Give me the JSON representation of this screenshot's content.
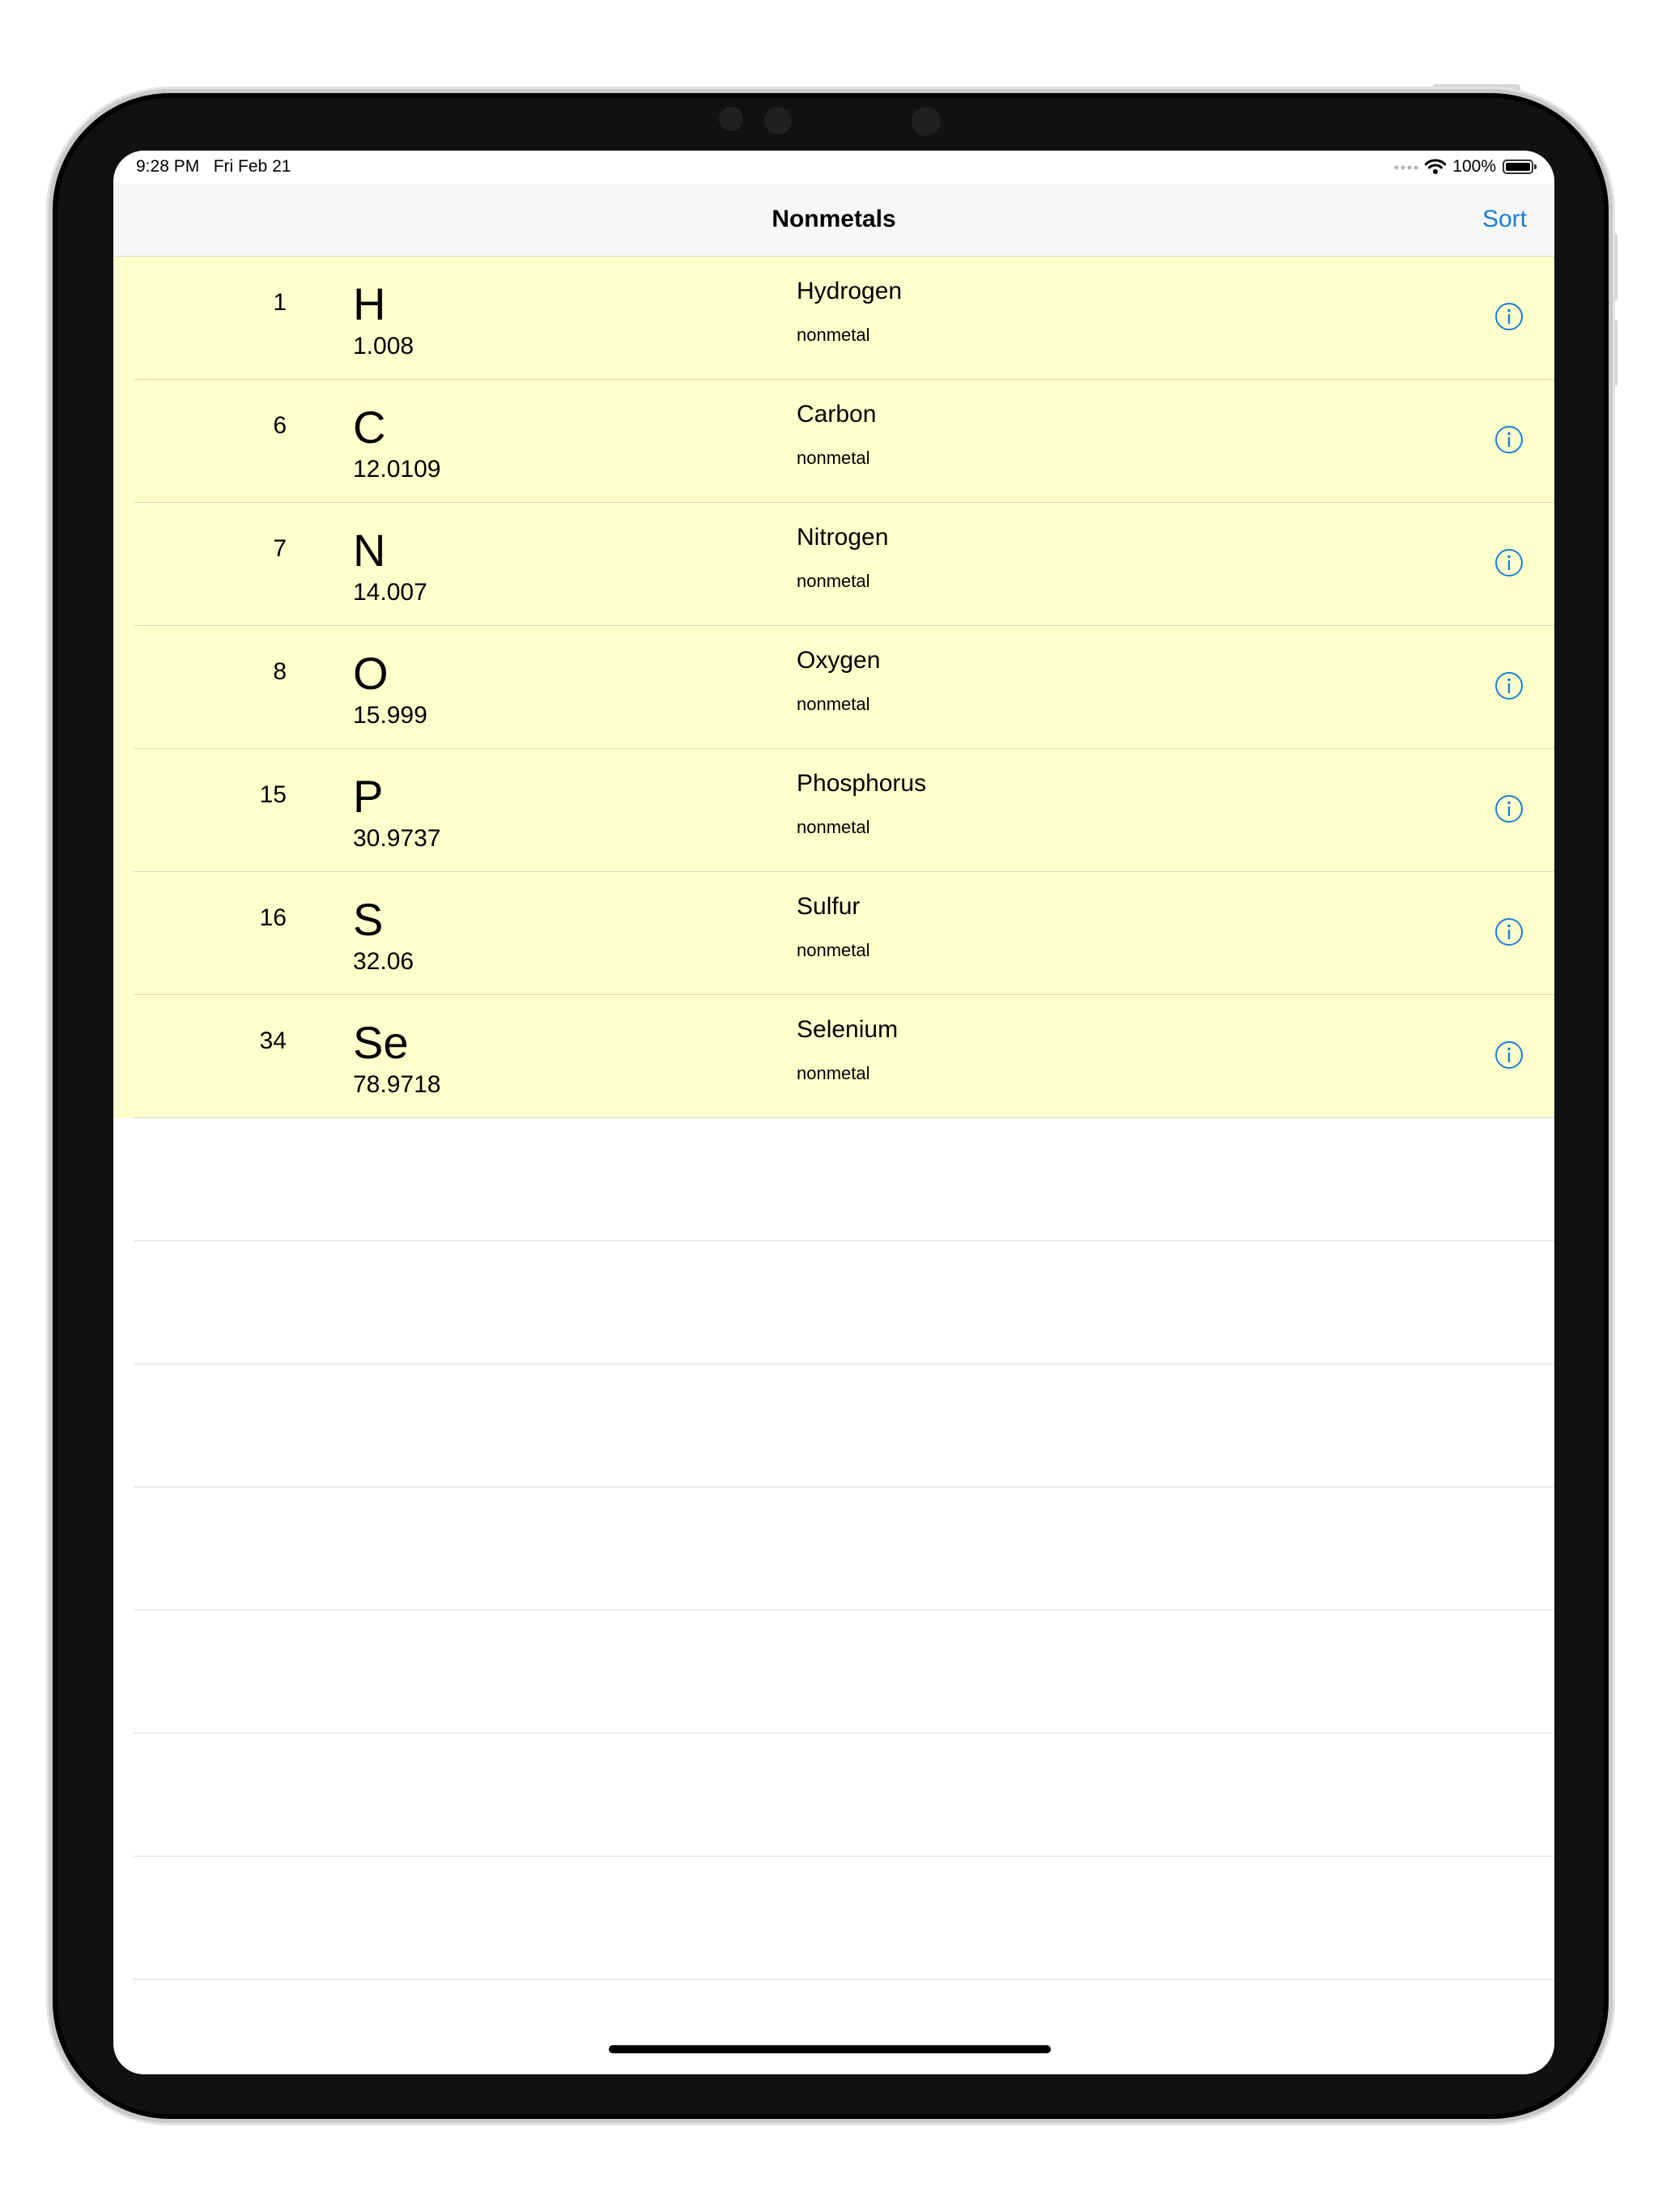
{
  "status": {
    "time": "9:28 PM",
    "date": "Fri Feb 21",
    "battery": "100%",
    "battery_level": 1.0,
    "signal_icon": "cellular-dots-icon",
    "wifi_icon": "wifi-icon"
  },
  "nav": {
    "title": "Nonmetals",
    "sort_label": "Sort"
  },
  "accent_color": "#1a7fd6",
  "row_color": "#ffffcc",
  "elements": [
    {
      "number": "1",
      "symbol": "H",
      "mass": "1.008",
      "name": "Hydrogen",
      "category": "nonmetal"
    },
    {
      "number": "6",
      "symbol": "C",
      "mass": "12.0109",
      "name": "Carbon",
      "category": "nonmetal"
    },
    {
      "number": "7",
      "symbol": "N",
      "mass": "14.007",
      "name": "Nitrogen",
      "category": "nonmetal"
    },
    {
      "number": "8",
      "symbol": "O",
      "mass": "15.999",
      "name": "Oxygen",
      "category": "nonmetal"
    },
    {
      "number": "15",
      "symbol": "P",
      "mass": "30.9737",
      "name": "Phosphorus",
      "category": "nonmetal"
    },
    {
      "number": "16",
      "symbol": "S",
      "mass": "32.06",
      "name": "Sulfur",
      "category": "nonmetal"
    },
    {
      "number": "34",
      "symbol": "Se",
      "mass": "78.9718",
      "name": "Selenium",
      "category": "nonmetal"
    }
  ]
}
